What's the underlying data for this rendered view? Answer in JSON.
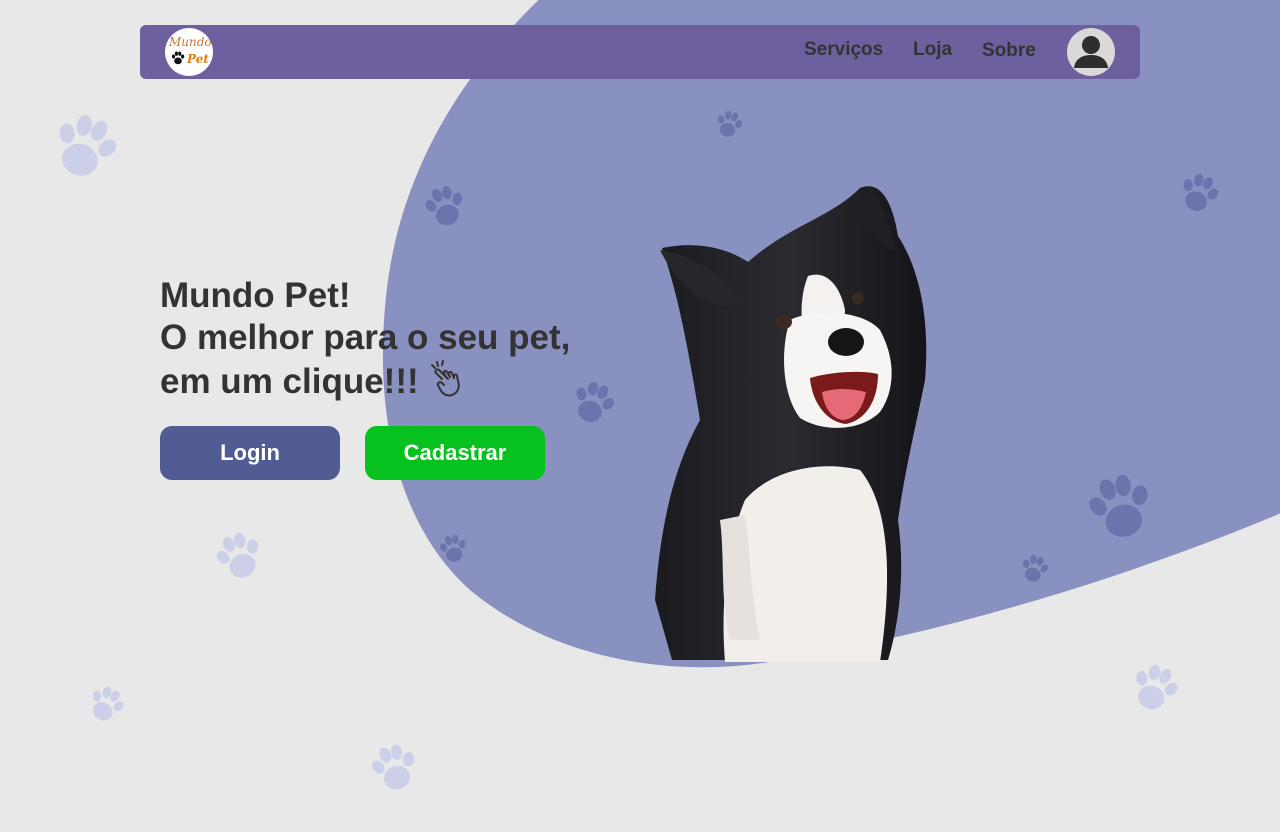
{
  "logo": {
    "line1": "Mundo",
    "line2": "Pet"
  },
  "nav": {
    "links": [
      "Serviços",
      "Loja",
      "Sobre"
    ]
  },
  "hero": {
    "line1": "Mundo Pet!",
    "line2": "O melhor para o seu pet,",
    "line3": "em um clique!!!"
  },
  "buttons": {
    "login": "Login",
    "signup": "Cadastrar"
  },
  "icons": {
    "logo_paw": "paw-icon",
    "pointer": "hand-pointer-icon",
    "user": "user-icon",
    "decor": "paw-print-icon"
  },
  "colors": {
    "background": "#e8e8e8",
    "blob": "#8891c0",
    "navbar": "#6e5f9f",
    "login_button": "#515c95",
    "signup_button": "#07c11e",
    "paw_light": "#c8cce8",
    "paw_dark": "#6b74ad"
  }
}
